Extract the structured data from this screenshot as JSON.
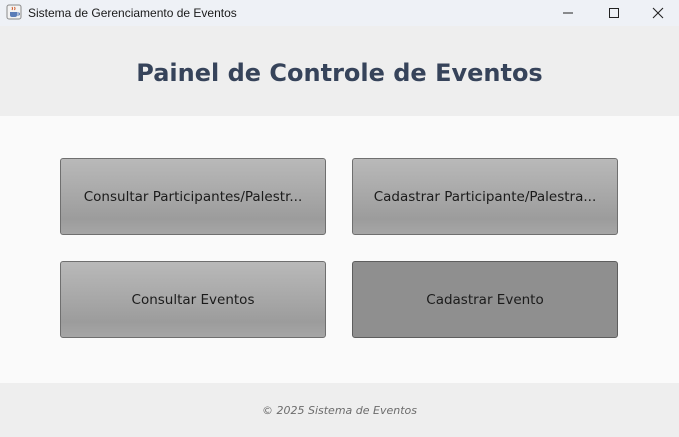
{
  "window": {
    "title": "Sistema de Gerenciamento de Eventos",
    "app_icon": "java-cup-icon"
  },
  "header": {
    "title": "Painel de Controle de Eventos"
  },
  "actions": {
    "consultar_participantes": "Consultar Participantes/Palestr...",
    "cadastrar_participante": "Cadastrar Participante/Palestra...",
    "consultar_eventos": "Consultar Eventos",
    "cadastrar_evento": "Cadastrar Evento"
  },
  "footer": {
    "text": "© 2025 Sistema de Eventos"
  },
  "colors": {
    "title_bar": "#eef1f6",
    "header_bg": "#eeeeee",
    "header_text": "#36435a",
    "button_gradient_top": "#b9b9b9",
    "button_gradient_bottom": "#9c9c9c",
    "button_hover": "#8f8f8f",
    "footer_text": "#6c6c6c"
  }
}
